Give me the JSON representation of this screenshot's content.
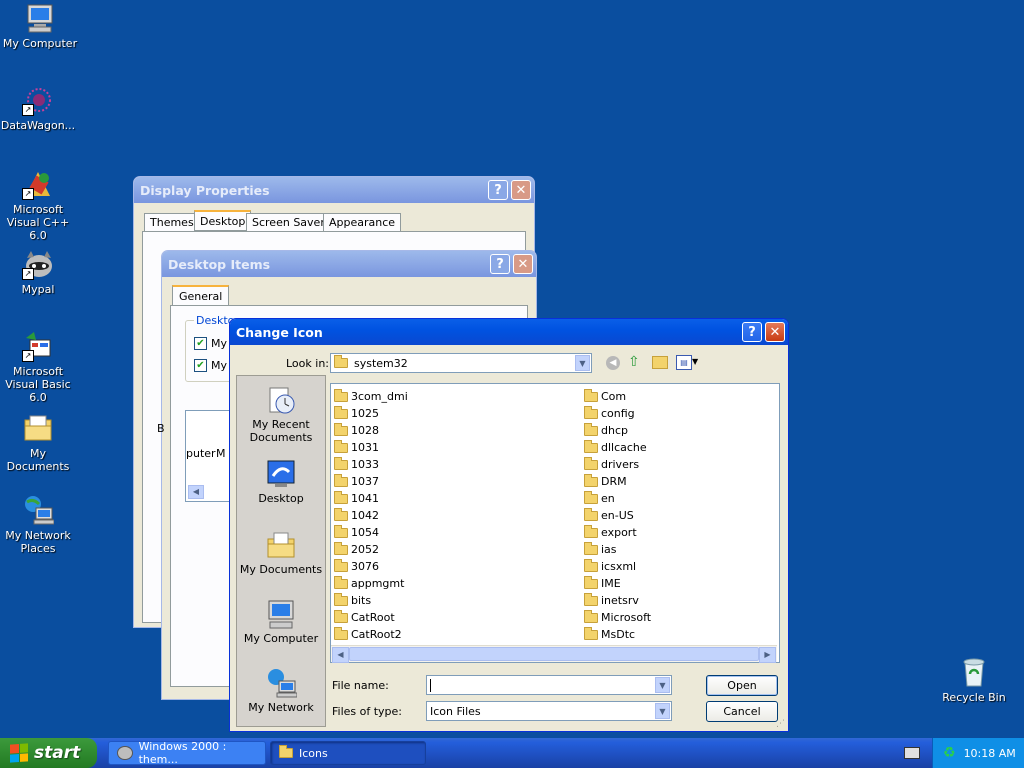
{
  "desktop": {
    "icons": [
      {
        "label": "My Computer",
        "icon": "computer-icon"
      },
      {
        "label": "DataWagon...",
        "icon": "datawagon-icon"
      },
      {
        "label": "Microsoft Visual C++ 6.0",
        "icon": "visual-cpp-icon"
      },
      {
        "label": "Mypal",
        "icon": "mypal-icon"
      },
      {
        "label": "Microsoft Visual Basic 6.0",
        "icon": "visual-basic-icon"
      },
      {
        "label": "My Documents",
        "icon": "documents-folder-icon"
      },
      {
        "label": "My Network Places",
        "icon": "network-places-icon"
      }
    ],
    "recycle_bin": {
      "label": "Recycle Bin"
    }
  },
  "display_properties": {
    "title": "Display Properties",
    "tabs": [
      "Themes",
      "Desktop",
      "Screen Saver",
      "Appearance"
    ],
    "selected_tab": "Desktop"
  },
  "desktop_items": {
    "title": "Desktop Items",
    "tab": "General",
    "group_label": "Deskto",
    "check1": "My",
    "check2": "My",
    "label_b": "B",
    "preview_text1": "puter",
    "preview_text2": "M"
  },
  "change_icon": {
    "title": "Change Icon",
    "look_in_label": "Look in:",
    "look_in_value": "system32",
    "places": [
      {
        "label": "My Recent Documents",
        "icon": "recent-documents-icon"
      },
      {
        "label": "Desktop",
        "icon": "desktop-icon"
      },
      {
        "label": "My Documents",
        "icon": "my-documents-icon"
      },
      {
        "label": "My Computer",
        "icon": "my-computer-icon"
      },
      {
        "label": "My Network",
        "icon": "my-network-icon"
      }
    ],
    "folders_col1": [
      "3com_dmi",
      "1025",
      "1028",
      "1031",
      "1033",
      "1037",
      "1041",
      "1042",
      "1054",
      "2052",
      "3076",
      "appmgmt",
      "bits",
      "CatRoot",
      "CatRoot2"
    ],
    "folders_col2": [
      "Com",
      "config",
      "dhcp",
      "dllcache",
      "drivers",
      "DRM",
      "en",
      "en-US",
      "export",
      "ias",
      "icsxml",
      "IME",
      "inetsrv",
      "Microsoft",
      "MsDtc"
    ],
    "file_name_label": "File name:",
    "file_name_value": "",
    "files_of_type_label": "Files of type:",
    "files_of_type_value": "Icon Files",
    "open_label": "Open",
    "cancel_label": "Cancel"
  },
  "taskbar": {
    "start_label": "start",
    "items": [
      {
        "label": "Windows 2000 : them...",
        "icon": "mypal-icon"
      },
      {
        "label": "Icons",
        "icon": "folder-icon"
      }
    ],
    "clock": "10:18 AM"
  }
}
